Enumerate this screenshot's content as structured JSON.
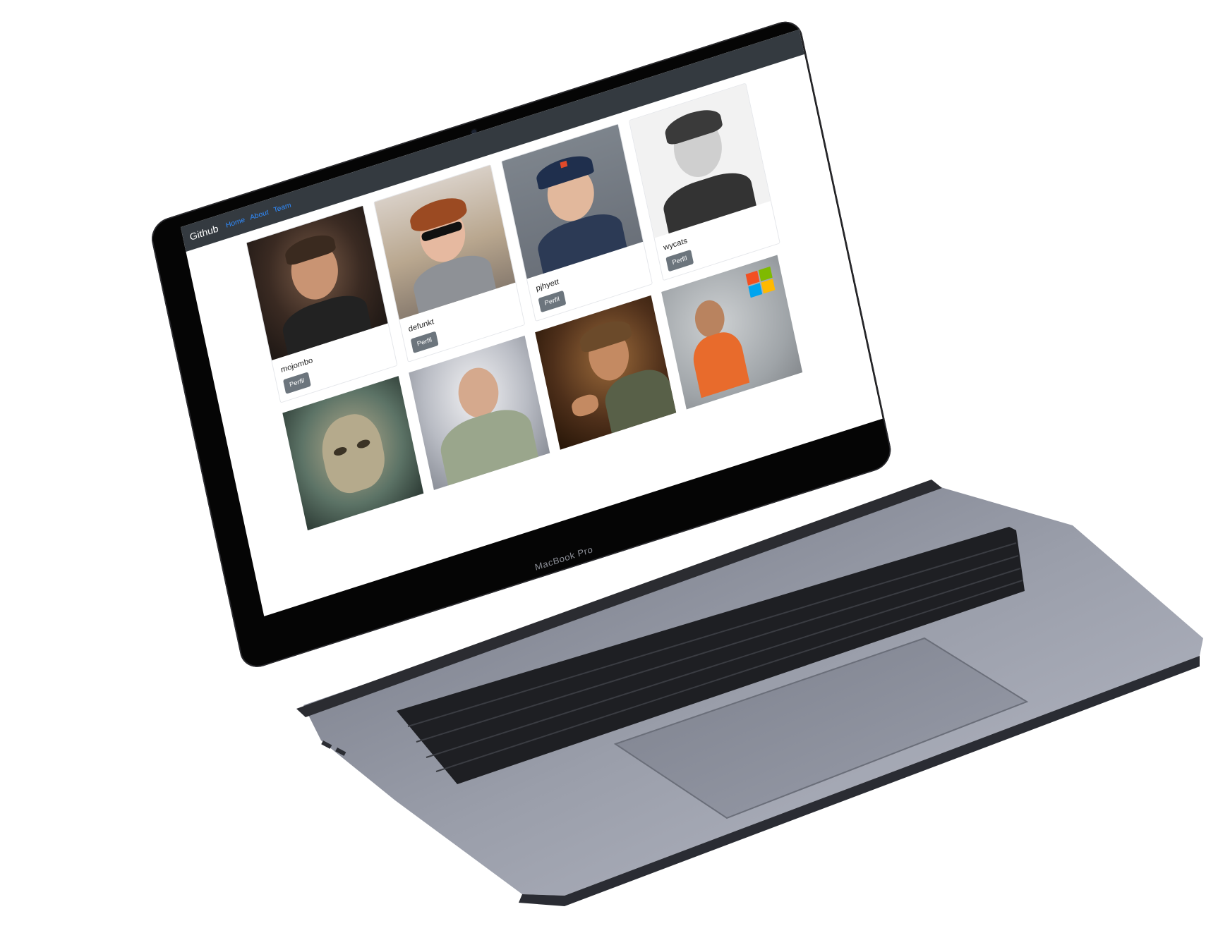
{
  "app": {
    "brand": "Github",
    "nav": [
      "Home",
      "About",
      "Team"
    ]
  },
  "users": [
    {
      "login": "mojombo",
      "button": "Perfil"
    },
    {
      "login": "defunkt",
      "button": "Perfil"
    },
    {
      "login": "pjhyett",
      "button": "Perfil"
    },
    {
      "login": "wycats",
      "button": "Perfil"
    }
  ],
  "laptop": {
    "model": "MacBook Pro",
    "color": "#8e929c"
  },
  "colors": {
    "navbar": "#343a40",
    "link": "#2f8cff",
    "button": "#6c757d",
    "ms_red": "#f25022",
    "ms_green": "#7fba00",
    "ms_blue": "#00a4ef",
    "ms_yellow": "#ffb900"
  }
}
